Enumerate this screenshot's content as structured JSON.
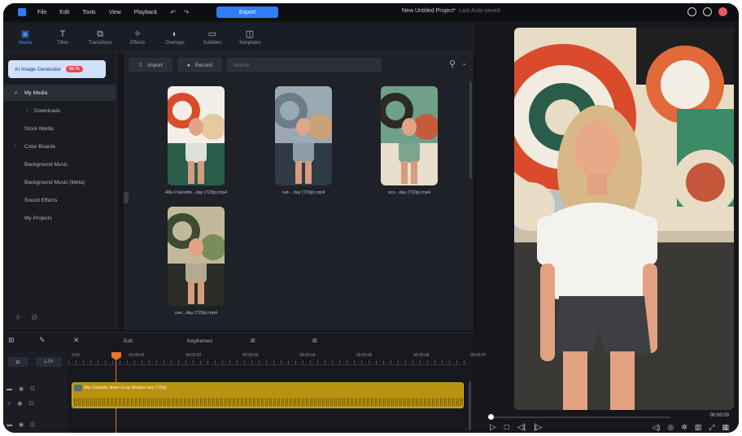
{
  "menubar": {
    "items": [
      "File",
      "Edit",
      "Tools",
      "View",
      "Playback"
    ],
    "export_label": "Export",
    "project_title": "New Untitled Project*",
    "project_subtitle": "Last Auto-saved"
  },
  "tool_tabs": [
    {
      "label": "Media",
      "icon": "media-icon",
      "glyph": "▣",
      "active": true
    },
    {
      "label": "Titles",
      "icon": "text-icon",
      "glyph": "T",
      "active": false
    },
    {
      "label": "Transitions",
      "icon": "transition-icon",
      "glyph": "⧉",
      "active": false
    },
    {
      "label": "Effects",
      "icon": "effects-icon",
      "glyph": "✧",
      "active": false
    },
    {
      "label": "Overlays",
      "icon": "overlay-icon",
      "glyph": "◐",
      "active": false
    },
    {
      "label": "Subtitles",
      "icon": "subtitles-icon",
      "glyph": "▭",
      "active": false
    },
    {
      "label": "Templates",
      "icon": "templates-icon",
      "glyph": "◫",
      "active": false
    }
  ],
  "sidebar": {
    "ai_button_label": "AI Image Generator",
    "ai_badge": "BETA",
    "items": [
      {
        "label": "My Media",
        "selected": true,
        "bullet": "▾"
      },
      {
        "label": "Downloads",
        "selected": false,
        "bullet": "›",
        "indent": true
      },
      {
        "label": "Stock Media",
        "selected": false,
        "bullet": ""
      },
      {
        "label": "Color Boards",
        "selected": false,
        "bullet": "›"
      },
      {
        "label": "Background Music",
        "selected": false,
        "bullet": ""
      },
      {
        "label": "Background Music (Meta)",
        "selected": false,
        "bullet": ""
      },
      {
        "label": "Sound Effects",
        "selected": false,
        "bullet": ""
      },
      {
        "label": "My Projects",
        "selected": false,
        "bullet": ""
      }
    ]
  },
  "media_toolbar": {
    "import_label": "Import",
    "record_label": "Record",
    "search_placeholder": "Search"
  },
  "media_items": [
    {
      "name": "Ally-Charlotte...day (720p).mp4",
      "palette": [
        "#d94b2b",
        "#e7c9a0",
        "#2a5c4a",
        "#f2efe8"
      ]
    },
    {
      "name": "out-...day (720p).mp4",
      "palette": [
        "#6b7c8a",
        "#c9a27a",
        "#2e3a44",
        "#9aa8b2"
      ]
    },
    {
      "name": "ace...day (720p).mp4",
      "palette": [
        "#2d2a26",
        "#c65a3a",
        "#e8dfcc",
        "#6fa08a"
      ]
    },
    {
      "name": "use...day (720p).mp4",
      "palette": [
        "#3e4a34",
        "#7a8c5a",
        "#2a2d28",
        "#c2b89a"
      ]
    }
  ],
  "timeline": {
    "toolbar": {
      "edit_label": "Edit",
      "keyframes_label": "Keyframes"
    },
    "speed_label": "1.0×",
    "ruler_labels": [
      "0:00",
      "00:00:01",
      "00:00:02",
      "00:00:03",
      "00:00:04",
      "00:00:05",
      "00:00:06",
      "00:00:07"
    ],
    "clip_name": "Ally-Charlotte Marie Grow Wisdom-day (720p)"
  },
  "preview": {
    "timecode": "00:00:03"
  },
  "colors": {
    "accent": "#2f7cf6",
    "clip": "#b8920f",
    "playhead": "#e9762b"
  }
}
